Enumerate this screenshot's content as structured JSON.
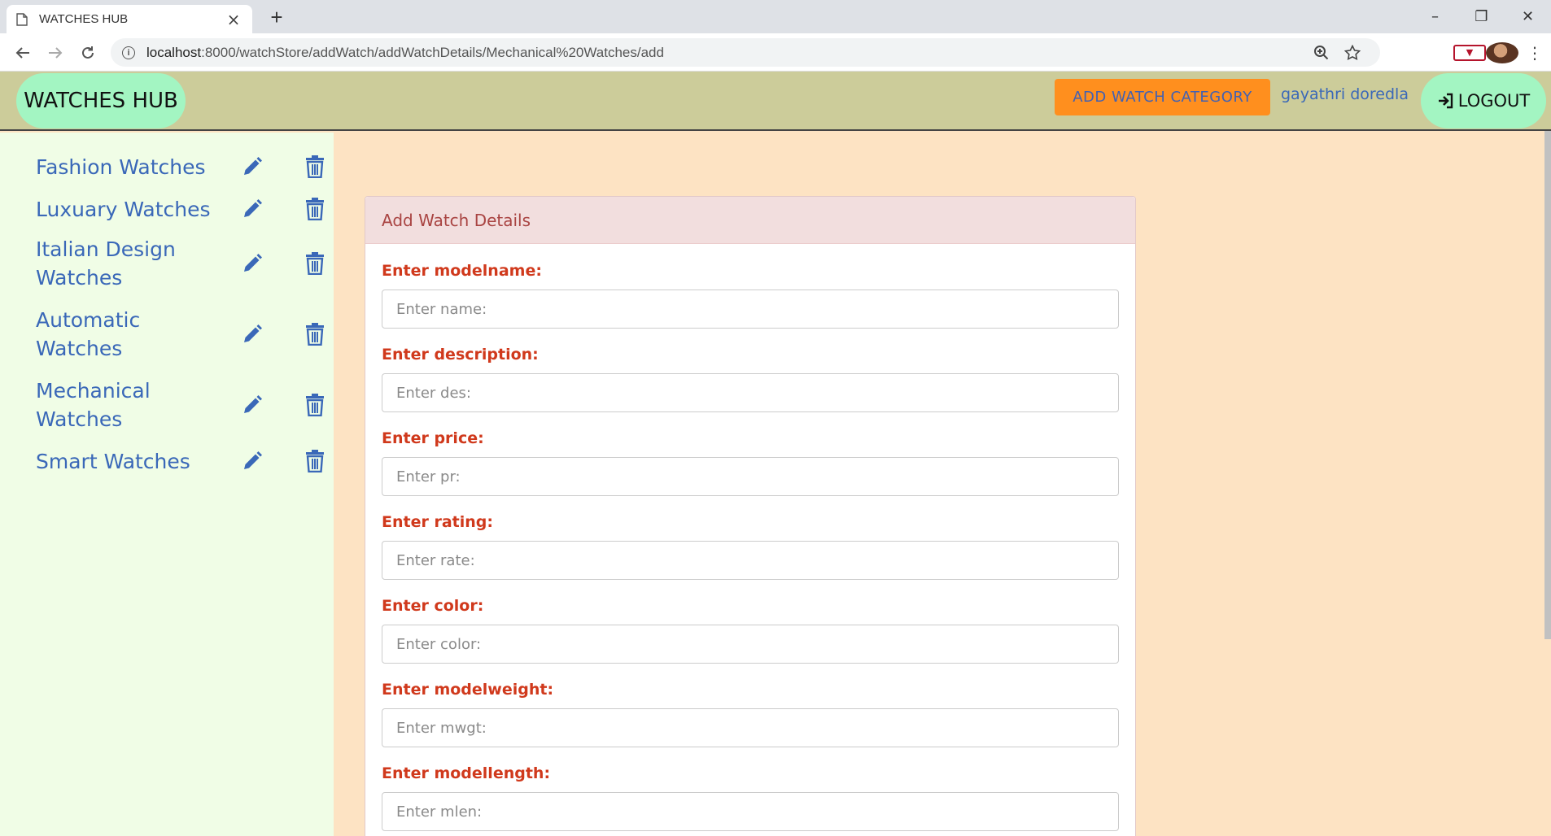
{
  "browser": {
    "tab_title": "WATCHES HUB",
    "new_tab_label": "+",
    "url_host": "localhost",
    "url_path": ":8000/watchStore/addWatch/addWatchDetails/Mechanical%20Watches/add"
  },
  "header": {
    "brand": "WATCHES HUB",
    "add_category_label": "ADD WATCH CATEGORY",
    "user_name": "gayathri doredla",
    "logout_label": "LOGOUT"
  },
  "sidebar": {
    "categories": [
      {
        "label": "Fashion Watches"
      },
      {
        "label": "Luxuary Watches"
      },
      {
        "label": "Italian Design Watches"
      },
      {
        "label": "Automatic Watches"
      },
      {
        "label": "Mechanical Watches"
      },
      {
        "label": "Smart Watches"
      }
    ]
  },
  "form": {
    "title": "Add Watch Details",
    "fields": [
      {
        "label": "Enter modelname:",
        "placeholder": "Enter name:"
      },
      {
        "label": "Enter description:",
        "placeholder": "Enter des:"
      },
      {
        "label": "Enter price:",
        "placeholder": "Enter pr:"
      },
      {
        "label": "Enter rating:",
        "placeholder": "Enter rate:"
      },
      {
        "label": "Enter color:",
        "placeholder": "Enter color:"
      },
      {
        "label": "Enter modelweight:",
        "placeholder": "Enter mwgt:"
      },
      {
        "label": "Enter modellength:",
        "placeholder": "Enter mlen:"
      }
    ]
  },
  "colors": {
    "header_bg": "#cccc9a",
    "brand_pill": "#a3f5c2",
    "accent_orange": "#ff8f1e",
    "link_blue": "#3a68b8",
    "label_red": "#d0391c",
    "page_bg": "#fde3c3",
    "sidebar_bg": "#f0fde6"
  }
}
